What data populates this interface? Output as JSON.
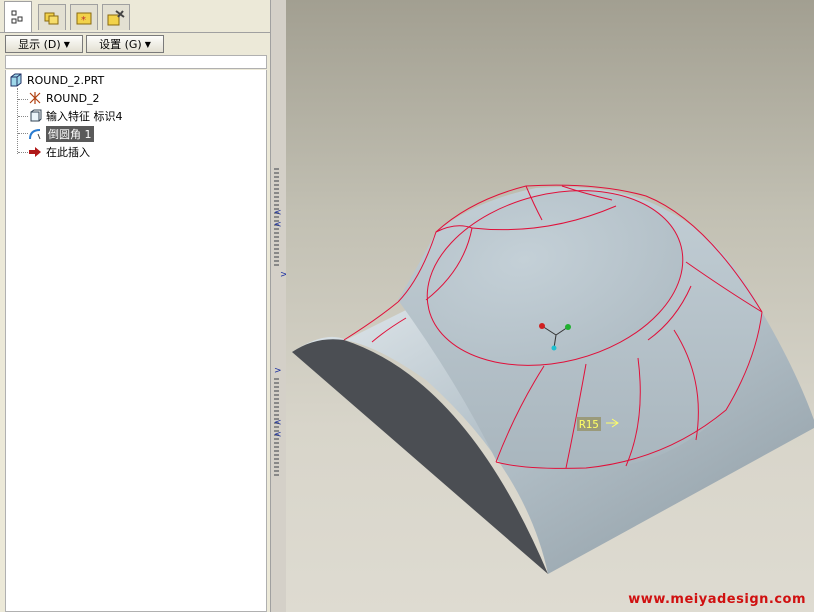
{
  "toolbar": {
    "show_label": "显示 (D)",
    "settings_label": "设置 (G)"
  },
  "tree": {
    "root": "ROUND_2.PRT",
    "items": [
      {
        "label": "ROUND_2",
        "icon": "datum-csys-icon"
      },
      {
        "label": "输入特征 标识4",
        "icon": "import-feature-icon"
      },
      {
        "label": "倒圆角 1",
        "icon": "round-feature-icon",
        "selected": true
      },
      {
        "label": "在此插入",
        "icon": "insert-here-arrow-icon"
      }
    ]
  },
  "viewport": {
    "dimension_label": "R15"
  },
  "watermark": "www.meiyadesign.com",
  "colors": {
    "edge_highlight": "#e0103a",
    "model_face": "#b9c6ce",
    "selection": "#5a5a5a"
  }
}
